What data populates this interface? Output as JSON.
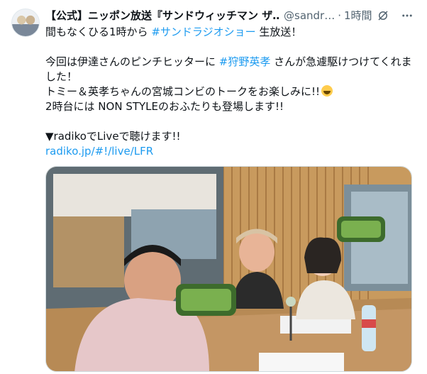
{
  "tweet": {
    "display_name": "【公式】ニッポン放送『サンドウィッチマン ザ…",
    "handle": "@sandr…",
    "separator": "·",
    "time": "1時間",
    "icons": [
      "grok-icon",
      "more-icon"
    ]
  },
  "body": {
    "line1_pre": "間もなくひる1時から ",
    "line1_tag": "#サンドラジオショー",
    "line1_post": " 生放送！",
    "line2_pre": "今回は伊達さんのピンチヒッターに ",
    "line2_tag": "#狩野英孝",
    "line2_post": " さんが急遽駆けつけてくれました！",
    "line3": "トミー＆英孝ちゃんの宮城コンビのトークをお楽しみに!!",
    "line3_emoji": "grinning-face-emoji",
    "line4": "2時台には NON STYLEのおふたりも登場します!!",
    "line5": "▼radikoでLiveで聴けます!!",
    "link": "radiko.jp/#!/live/LFR"
  },
  "media": {
    "description": "photo",
    "colors": {
      "wall_wood": "#c89a5e",
      "desk": "#b78a55",
      "window": "#7c8f9a",
      "sign_green": "#3d6b2c"
    }
  }
}
